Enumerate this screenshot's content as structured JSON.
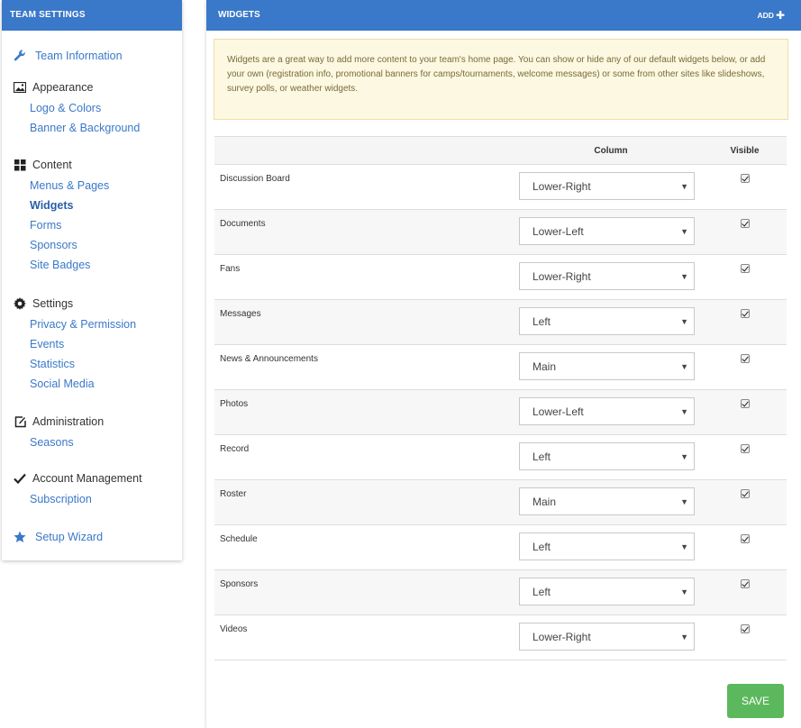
{
  "sidebar": {
    "title": "TEAM SETTINGS",
    "team_information": "Team Information",
    "appearance": {
      "label": "Appearance",
      "items": [
        "Logo & Colors",
        "Banner & Background"
      ]
    },
    "content": {
      "label": "Content",
      "items": [
        "Menus & Pages",
        "Widgets",
        "Forms",
        "Sponsors",
        "Site Badges"
      ],
      "active": "Widgets"
    },
    "settings": {
      "label": "Settings",
      "items": [
        "Privacy & Permission",
        "Events",
        "Statistics",
        "Social Media"
      ]
    },
    "administration": {
      "label": "Administration",
      "items": [
        "Seasons"
      ]
    },
    "account_management": {
      "label": "Account Management",
      "items": [
        "Subscription"
      ]
    },
    "setup_wizard": "Setup Wizard"
  },
  "main": {
    "title": "WIDGETS",
    "add_label": "ADD",
    "info_text": "Widgets are a great way to add more content to your team's home page. You can show or hide any of our default widgets below, or add your own (registration info, promotional banners for camps/tournaments, welcome messages) or some from other sites like slideshows, survey polls, or weather widgets.",
    "table": {
      "headers": [
        "",
        "Column",
        "Visible"
      ],
      "rows": [
        {
          "name": "Discussion Board",
          "column": "Lower-Right",
          "visible": true
        },
        {
          "name": "Documents",
          "column": "Lower-Left",
          "visible": true
        },
        {
          "name": "Fans",
          "column": "Lower-Right",
          "visible": true
        },
        {
          "name": "Messages",
          "column": "Left",
          "visible": true
        },
        {
          "name": "News & Announcements",
          "column": "Main",
          "visible": true
        },
        {
          "name": "Photos",
          "column": "Lower-Left",
          "visible": true
        },
        {
          "name": "Record",
          "column": "Left",
          "visible": true
        },
        {
          "name": "Roster",
          "column": "Main",
          "visible": true
        },
        {
          "name": "Schedule",
          "column": "Left",
          "visible": true
        },
        {
          "name": "Sponsors",
          "column": "Left",
          "visible": true
        },
        {
          "name": "Videos",
          "column": "Lower-Right",
          "visible": true
        }
      ]
    },
    "save_label": "SAVE"
  },
  "colors": {
    "header_blue": "#3a78c9",
    "link_blue": "#3a78c9",
    "save_green": "#5cb85c",
    "info_bg": "#fcf8e1"
  },
  "icons": {
    "team_information": "wrench-icon",
    "appearance": "image-icon",
    "content": "grid-icon",
    "settings": "gear-icon",
    "administration": "edit-icon",
    "account_management": "check-icon",
    "setup_wizard": "star-icon",
    "add": "plus-icon",
    "select": "caret-down-icon"
  }
}
